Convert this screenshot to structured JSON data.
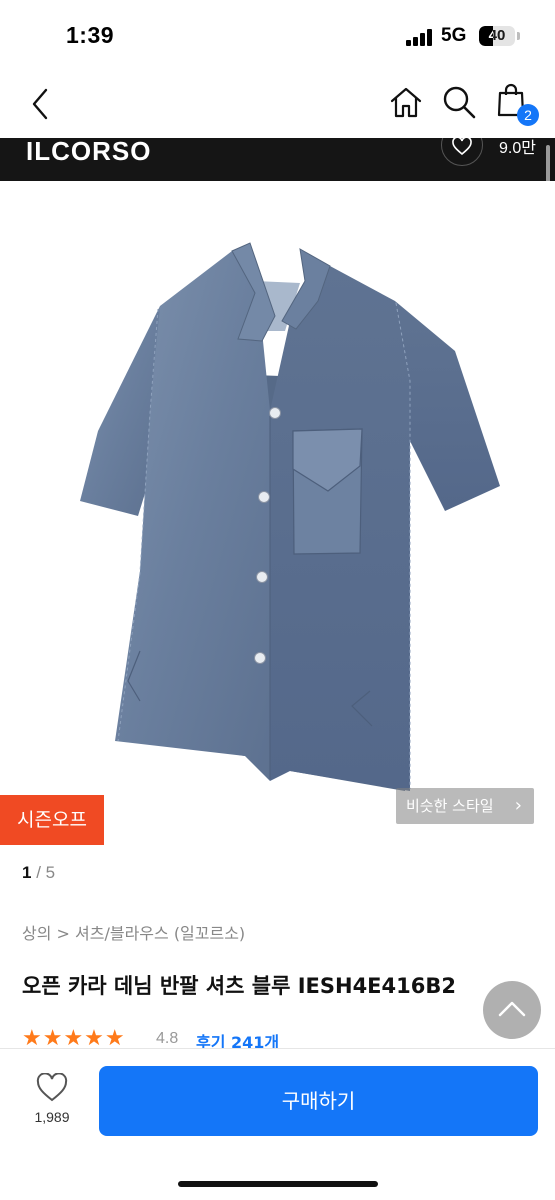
{
  "status_bar": {
    "time": "1:39",
    "network": "5G",
    "battery_level": "40"
  },
  "nav": {
    "cart_badge": "2"
  },
  "brand": {
    "name": "ILCORSO",
    "likes": "9.0만"
  },
  "gallery": {
    "season_tag": "시즌오프",
    "similar_style_label": "비슷한 스타일",
    "page_current": "1",
    "page_sep": " / ",
    "page_total": "5"
  },
  "product": {
    "breadcrumb": "상의 > 셔츠/블라우스 (일꼬르소)",
    "title": "오픈 카라 데님 반팔 셔츠 블루 IESH4E416B2",
    "stars": "★★★★★",
    "rating": "4.8",
    "review_link": "후기 241개"
  },
  "bottom_bar": {
    "wish_count": "1,989",
    "buy_label": "구매하기"
  },
  "colors": {
    "accent": "#1476f8",
    "season_tag": "#f04a23",
    "star": "#ff7a1a",
    "denim": "#6f84a3"
  }
}
